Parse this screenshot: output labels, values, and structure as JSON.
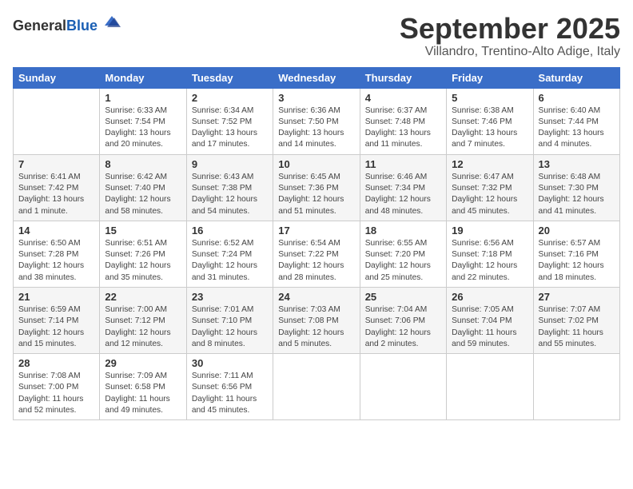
{
  "header": {
    "logo_general": "General",
    "logo_blue": "Blue",
    "month": "September 2025",
    "location": "Villandro, Trentino-Alto Adige, Italy"
  },
  "days_of_week": [
    "Sunday",
    "Monday",
    "Tuesday",
    "Wednesday",
    "Thursday",
    "Friday",
    "Saturday"
  ],
  "weeks": [
    [
      {
        "day": "",
        "info": ""
      },
      {
        "day": "1",
        "info": "Sunrise: 6:33 AM\nSunset: 7:54 PM\nDaylight: 13 hours\nand 20 minutes."
      },
      {
        "day": "2",
        "info": "Sunrise: 6:34 AM\nSunset: 7:52 PM\nDaylight: 13 hours\nand 17 minutes."
      },
      {
        "day": "3",
        "info": "Sunrise: 6:36 AM\nSunset: 7:50 PM\nDaylight: 13 hours\nand 14 minutes."
      },
      {
        "day": "4",
        "info": "Sunrise: 6:37 AM\nSunset: 7:48 PM\nDaylight: 13 hours\nand 11 minutes."
      },
      {
        "day": "5",
        "info": "Sunrise: 6:38 AM\nSunset: 7:46 PM\nDaylight: 13 hours\nand 7 minutes."
      },
      {
        "day": "6",
        "info": "Sunrise: 6:40 AM\nSunset: 7:44 PM\nDaylight: 13 hours\nand 4 minutes."
      }
    ],
    [
      {
        "day": "7",
        "info": "Sunrise: 6:41 AM\nSunset: 7:42 PM\nDaylight: 13 hours\nand 1 minute."
      },
      {
        "day": "8",
        "info": "Sunrise: 6:42 AM\nSunset: 7:40 PM\nDaylight: 12 hours\nand 58 minutes."
      },
      {
        "day": "9",
        "info": "Sunrise: 6:43 AM\nSunset: 7:38 PM\nDaylight: 12 hours\nand 54 minutes."
      },
      {
        "day": "10",
        "info": "Sunrise: 6:45 AM\nSunset: 7:36 PM\nDaylight: 12 hours\nand 51 minutes."
      },
      {
        "day": "11",
        "info": "Sunrise: 6:46 AM\nSunset: 7:34 PM\nDaylight: 12 hours\nand 48 minutes."
      },
      {
        "day": "12",
        "info": "Sunrise: 6:47 AM\nSunset: 7:32 PM\nDaylight: 12 hours\nand 45 minutes."
      },
      {
        "day": "13",
        "info": "Sunrise: 6:48 AM\nSunset: 7:30 PM\nDaylight: 12 hours\nand 41 minutes."
      }
    ],
    [
      {
        "day": "14",
        "info": "Sunrise: 6:50 AM\nSunset: 7:28 PM\nDaylight: 12 hours\nand 38 minutes."
      },
      {
        "day": "15",
        "info": "Sunrise: 6:51 AM\nSunset: 7:26 PM\nDaylight: 12 hours\nand 35 minutes."
      },
      {
        "day": "16",
        "info": "Sunrise: 6:52 AM\nSunset: 7:24 PM\nDaylight: 12 hours\nand 31 minutes."
      },
      {
        "day": "17",
        "info": "Sunrise: 6:54 AM\nSunset: 7:22 PM\nDaylight: 12 hours\nand 28 minutes."
      },
      {
        "day": "18",
        "info": "Sunrise: 6:55 AM\nSunset: 7:20 PM\nDaylight: 12 hours\nand 25 minutes."
      },
      {
        "day": "19",
        "info": "Sunrise: 6:56 AM\nSunset: 7:18 PM\nDaylight: 12 hours\nand 22 minutes."
      },
      {
        "day": "20",
        "info": "Sunrise: 6:57 AM\nSunset: 7:16 PM\nDaylight: 12 hours\nand 18 minutes."
      }
    ],
    [
      {
        "day": "21",
        "info": "Sunrise: 6:59 AM\nSunset: 7:14 PM\nDaylight: 12 hours\nand 15 minutes."
      },
      {
        "day": "22",
        "info": "Sunrise: 7:00 AM\nSunset: 7:12 PM\nDaylight: 12 hours\nand 12 minutes."
      },
      {
        "day": "23",
        "info": "Sunrise: 7:01 AM\nSunset: 7:10 PM\nDaylight: 12 hours\nand 8 minutes."
      },
      {
        "day": "24",
        "info": "Sunrise: 7:03 AM\nSunset: 7:08 PM\nDaylight: 12 hours\nand 5 minutes."
      },
      {
        "day": "25",
        "info": "Sunrise: 7:04 AM\nSunset: 7:06 PM\nDaylight: 12 hours\nand 2 minutes."
      },
      {
        "day": "26",
        "info": "Sunrise: 7:05 AM\nSunset: 7:04 PM\nDaylight: 11 hours\nand 59 minutes."
      },
      {
        "day": "27",
        "info": "Sunrise: 7:07 AM\nSunset: 7:02 PM\nDaylight: 11 hours\nand 55 minutes."
      }
    ],
    [
      {
        "day": "28",
        "info": "Sunrise: 7:08 AM\nSunset: 7:00 PM\nDaylight: 11 hours\nand 52 minutes."
      },
      {
        "day": "29",
        "info": "Sunrise: 7:09 AM\nSunset: 6:58 PM\nDaylight: 11 hours\nand 49 minutes."
      },
      {
        "day": "30",
        "info": "Sunrise: 7:11 AM\nSunset: 6:56 PM\nDaylight: 11 hours\nand 45 minutes."
      },
      {
        "day": "",
        "info": ""
      },
      {
        "day": "",
        "info": ""
      },
      {
        "day": "",
        "info": ""
      },
      {
        "day": "",
        "info": ""
      }
    ]
  ]
}
